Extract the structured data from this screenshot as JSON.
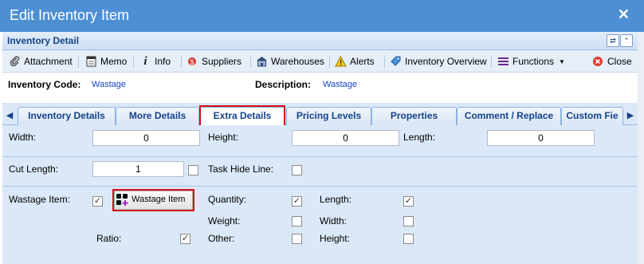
{
  "window": {
    "title": "Edit Inventory Item"
  },
  "panel": {
    "title": "Inventory Detail"
  },
  "toolbar": {
    "attachment": "Attachment",
    "memo": "Memo",
    "info": "Info",
    "suppliers": "Suppliers",
    "warehouses": "Warehouses",
    "alerts": "Alerts",
    "inventory_overview": "Inventory Overview",
    "functions": "Functions",
    "close": "Close"
  },
  "header": {
    "code_label": "Inventory Code:",
    "code_value": "Wastage",
    "desc_label": "Description:",
    "desc_value": "Wastage"
  },
  "tabs": [
    "Inventory Details",
    "More Details",
    "Extra Details",
    "Pricing Levels",
    "Properties",
    "Comment / Replace",
    "Custom Fie"
  ],
  "active_tab": "Extra Details",
  "fields": {
    "width_label": "Width:",
    "width_value": "0",
    "height_label": "Height:",
    "height_value": "0",
    "length_label": "Length:",
    "length_value": "0",
    "cut_length_label": "Cut Length:",
    "cut_length_value": "1",
    "task_hide_label": "Task Hide Line:"
  },
  "wastage": {
    "item_label": "Wastage Item:",
    "button_label": "Wastage Item",
    "ratio_label": "Ratio:",
    "quantity_label": "Quantity:",
    "weight_label": "Weight:",
    "other_label": "Other:",
    "length_label": "Length:",
    "width_label": "Width:",
    "height_label": "Height:"
  },
  "checks": {
    "cut_length": false,
    "task_hide_line": false,
    "wastage_item": true,
    "ratio": true,
    "quantity": true,
    "weight": false,
    "other": false,
    "length": true,
    "width": false,
    "height": false
  },
  "colors": {
    "titlebar": "#4e8fd4",
    "highlight": "#d0111b",
    "link_value": "#1545c8"
  }
}
